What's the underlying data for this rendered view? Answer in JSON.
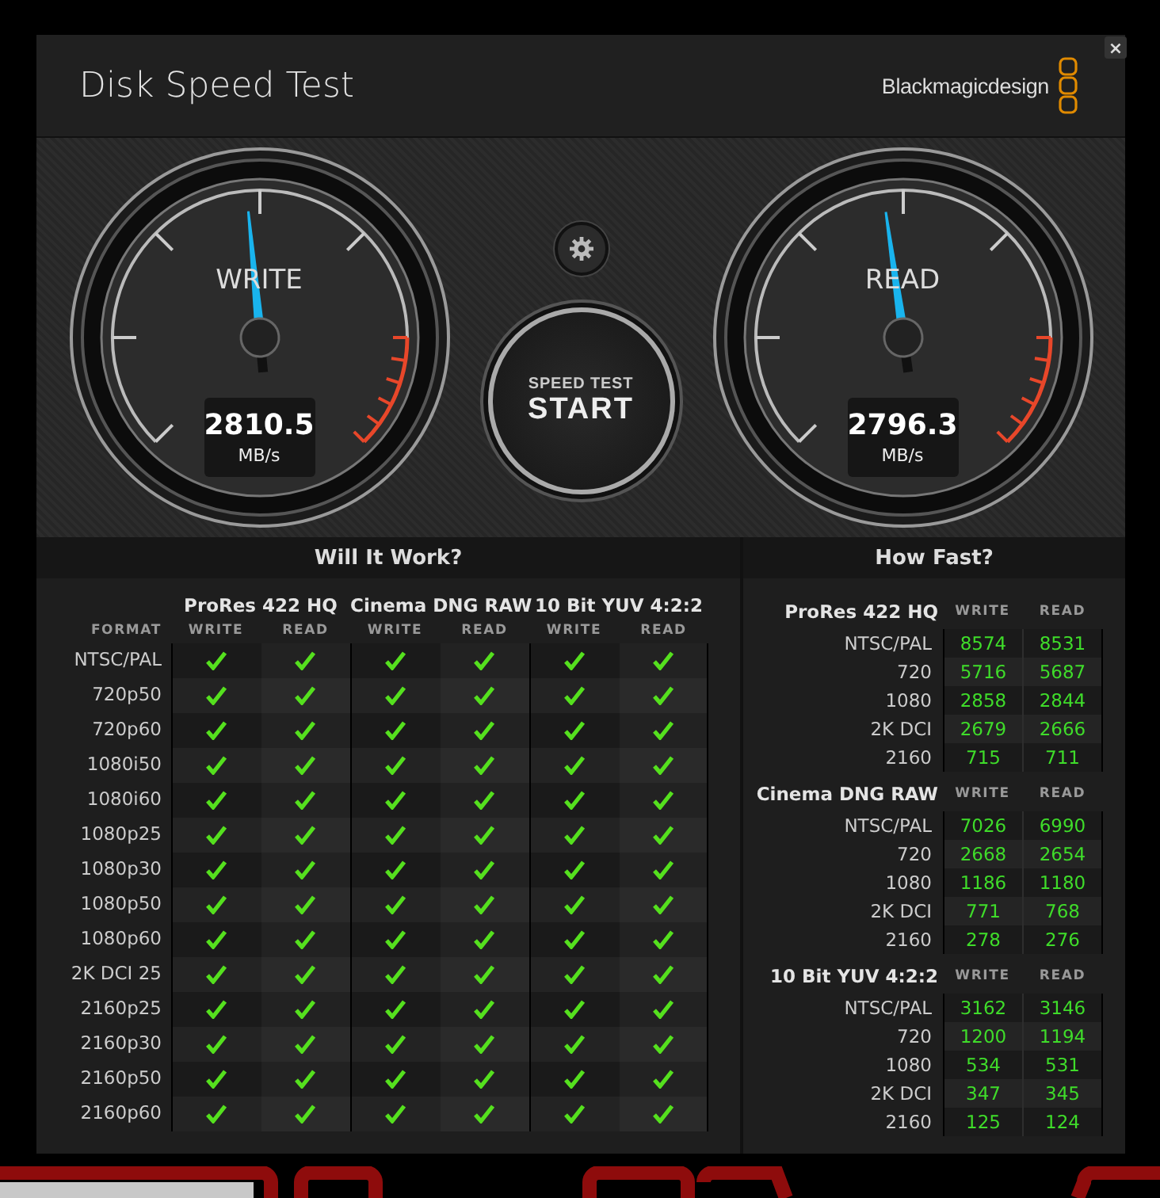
{
  "window": {
    "title": "Disk Speed Test",
    "brand": "Blackmagicdesign",
    "close": "×"
  },
  "gauges": [
    {
      "label": "WRITE",
      "value": "2810.5",
      "unit": "MB/s",
      "level": 0.48
    },
    {
      "label": "READ",
      "value": "2796.3",
      "unit": "MB/s",
      "level": 0.47
    }
  ],
  "start_button": {
    "caption": "SPEED TEST",
    "label": "START"
  },
  "will_it_work": {
    "title": "Will It Work?",
    "format_label": "FORMAT",
    "codecs": [
      "ProRes 422 HQ",
      "Cinema DNG RAW",
      "10 Bit YUV 4:2:2"
    ],
    "subcolumns": [
      "WRITE",
      "READ",
      "WRITE",
      "READ",
      "WRITE",
      "READ"
    ],
    "rows": [
      {
        "format": "NTSC/PAL",
        "ok": [
          true,
          true,
          true,
          true,
          true,
          true
        ]
      },
      {
        "format": "720p50",
        "ok": [
          true,
          true,
          true,
          true,
          true,
          true
        ]
      },
      {
        "format": "720p60",
        "ok": [
          true,
          true,
          true,
          true,
          true,
          true
        ]
      },
      {
        "format": "1080i50",
        "ok": [
          true,
          true,
          true,
          true,
          true,
          true
        ]
      },
      {
        "format": "1080i60",
        "ok": [
          true,
          true,
          true,
          true,
          true,
          true
        ]
      },
      {
        "format": "1080p25",
        "ok": [
          true,
          true,
          true,
          true,
          true,
          true
        ]
      },
      {
        "format": "1080p30",
        "ok": [
          true,
          true,
          true,
          true,
          true,
          true
        ]
      },
      {
        "format": "1080p50",
        "ok": [
          true,
          true,
          true,
          true,
          true,
          true
        ]
      },
      {
        "format": "1080p60",
        "ok": [
          true,
          true,
          true,
          true,
          true,
          true
        ]
      },
      {
        "format": "2K DCI 25",
        "ok": [
          true,
          true,
          true,
          true,
          true,
          true
        ]
      },
      {
        "format": "2160p25",
        "ok": [
          true,
          true,
          true,
          true,
          true,
          true
        ]
      },
      {
        "format": "2160p30",
        "ok": [
          true,
          true,
          true,
          true,
          true,
          true
        ]
      },
      {
        "format": "2160p50",
        "ok": [
          true,
          true,
          true,
          true,
          true,
          true
        ]
      },
      {
        "format": "2160p60",
        "ok": [
          true,
          true,
          true,
          true,
          true,
          true
        ]
      }
    ]
  },
  "how_fast": {
    "title": "How Fast?",
    "groups": [
      {
        "name": "ProRes 422 HQ",
        "write_label": "WRITE",
        "read_label": "READ",
        "rows": [
          {
            "label": "NTSC/PAL",
            "write": "8574",
            "read": "8531"
          },
          {
            "label": "720",
            "write": "5716",
            "read": "5687"
          },
          {
            "label": "1080",
            "write": "2858",
            "read": "2844"
          },
          {
            "label": "2K DCI",
            "write": "2679",
            "read": "2666"
          },
          {
            "label": "2160",
            "write": "715",
            "read": "711"
          }
        ]
      },
      {
        "name": "Cinema DNG RAW",
        "write_label": "WRITE",
        "read_label": "READ",
        "rows": [
          {
            "label": "NTSC/PAL",
            "write": "7026",
            "read": "6990"
          },
          {
            "label": "720",
            "write": "2668",
            "read": "2654"
          },
          {
            "label": "1080",
            "write": "1186",
            "read": "1180"
          },
          {
            "label": "2K DCI",
            "write": "771",
            "read": "768"
          },
          {
            "label": "2160",
            "write": "278",
            "read": "276"
          }
        ]
      },
      {
        "name": "10 Bit YUV 4:2:2",
        "write_label": "WRITE",
        "read_label": "READ",
        "rows": [
          {
            "label": "NTSC/PAL",
            "write": "3162",
            "read": "3146"
          },
          {
            "label": "720",
            "write": "1200",
            "read": "1194"
          },
          {
            "label": "1080",
            "write": "534",
            "read": "531"
          },
          {
            "label": "2K DCI",
            "write": "347",
            "read": "345"
          },
          {
            "label": "2160",
            "write": "125",
            "read": "124"
          }
        ]
      }
    ]
  }
}
